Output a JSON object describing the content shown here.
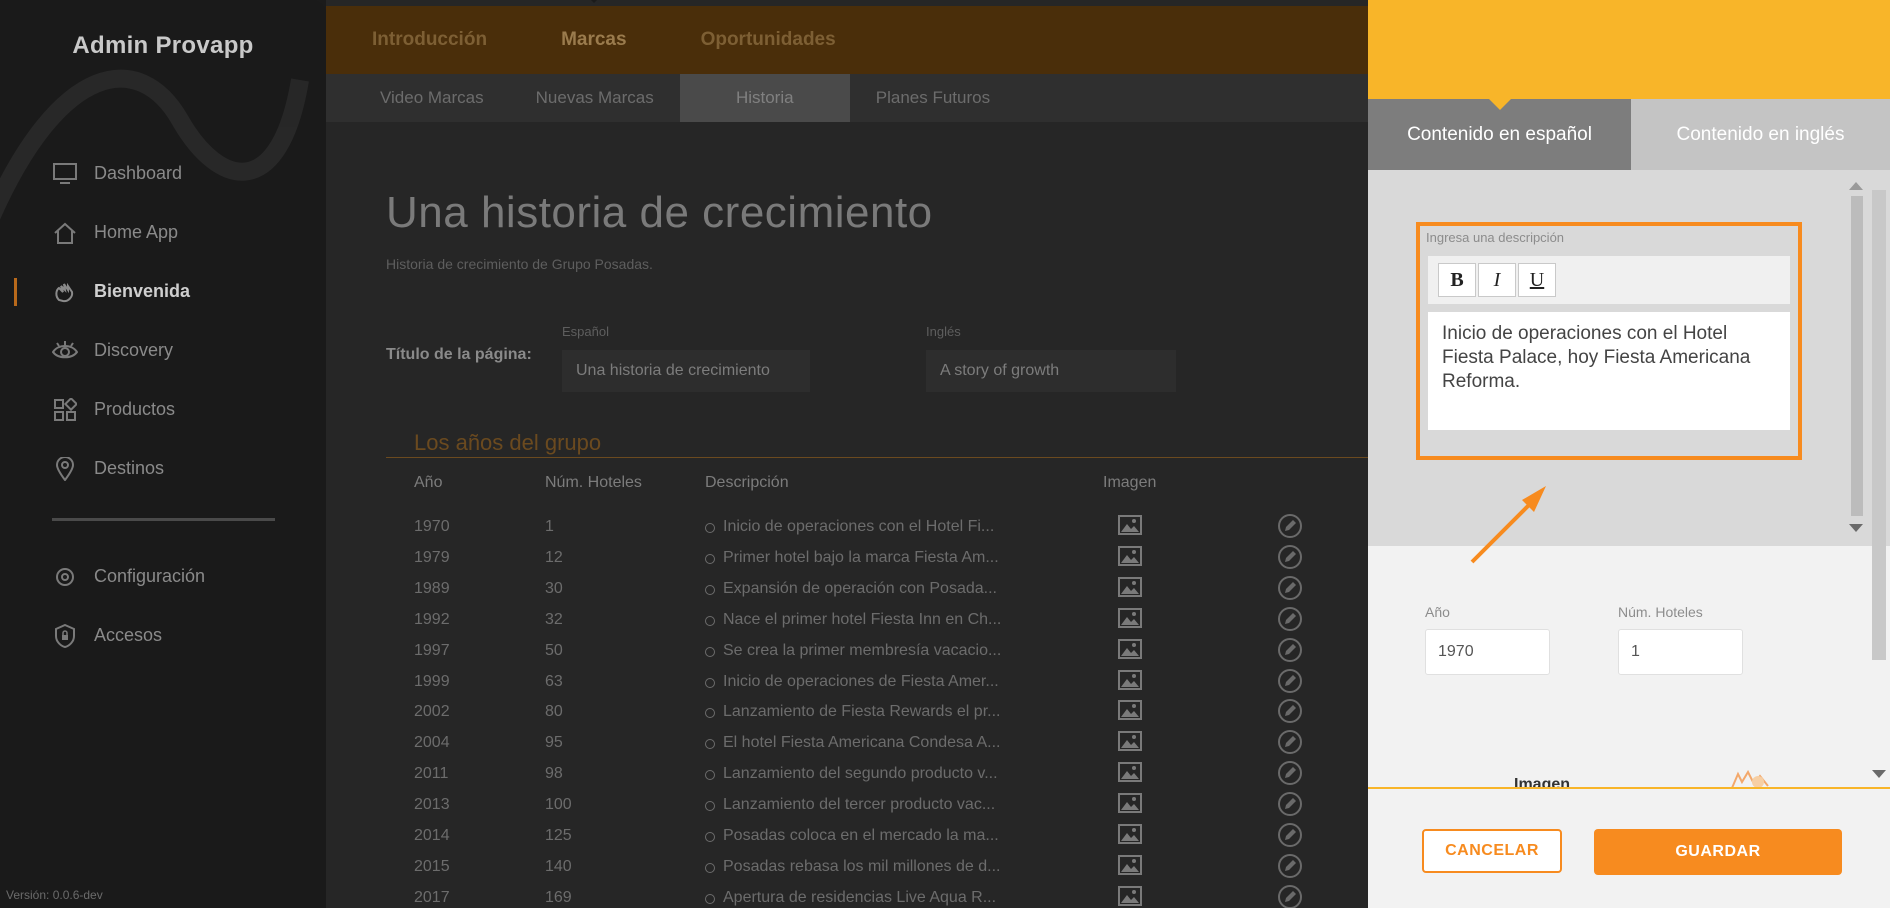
{
  "app": {
    "brand": "Admin Provapp",
    "version": "Versión: 0.0.6-dev"
  },
  "sidebar": {
    "items": [
      {
        "label": "Dashboard",
        "icon": "monitor-icon"
      },
      {
        "label": "Home App",
        "icon": "home-icon"
      },
      {
        "label": "Bienvenida",
        "icon": "wave-hand-icon",
        "active": true
      },
      {
        "label": "Discovery",
        "icon": "eye-icon"
      },
      {
        "label": "Productos",
        "icon": "grid-icon"
      },
      {
        "label": "Destinos",
        "icon": "location-pin-icon"
      }
    ],
    "bottom_items": [
      {
        "label": "Configuración",
        "icon": "gear-icon"
      },
      {
        "label": "Accesos",
        "icon": "shield-lock-icon"
      }
    ]
  },
  "topnav": {
    "items": [
      "Introducción",
      "Marcas",
      "Oportunidades"
    ],
    "active": "Marcas"
  },
  "subnav": {
    "items": [
      "Video Marcas",
      "Nuevas Marcas",
      "Historia",
      "Planes Futuros"
    ],
    "active": "Historia"
  },
  "page": {
    "title": "Una historia de crecimiento",
    "subtitle": "Historia de crecimiento de Grupo Posadas.",
    "title_field_label": "Título de la página:",
    "lang_es": "Español",
    "lang_en": "Inglés",
    "title_es": "Una historia de crecimiento",
    "title_en": "A story of growth",
    "section": "Los años del grupo"
  },
  "table": {
    "headers": {
      "year": "Año",
      "hotels": "Núm. Hoteles",
      "description": "Descripción",
      "image": "Imagen"
    },
    "rows": [
      {
        "year": "1970",
        "hotels": "1",
        "desc": "Inicio de operaciones con el Hotel Fi..."
      },
      {
        "year": "1979",
        "hotels": "12",
        "desc": "Primer hotel bajo la marca Fiesta Am..."
      },
      {
        "year": "1989",
        "hotels": "30",
        "desc": "Expansión de operación con Posada..."
      },
      {
        "year": "1992",
        "hotels": "32",
        "desc": "Nace el primer hotel Fiesta Inn en Ch..."
      },
      {
        "year": "1997",
        "hotels": "50",
        "desc": "Se crea la primer membresía vacacio..."
      },
      {
        "year": "1999",
        "hotels": "63",
        "desc": "Inicio de operaciones de Fiesta Amer..."
      },
      {
        "year": "2002",
        "hotels": "80",
        "desc": "Lanzamiento de Fiesta Rewards el pr..."
      },
      {
        "year": "2004",
        "hotels": "95",
        "desc": "El hotel Fiesta Americana Condesa A..."
      },
      {
        "year": "2011",
        "hotels": "98",
        "desc": "Lanzamiento del segundo producto v..."
      },
      {
        "year": "2013",
        "hotels": "100",
        "desc": "Lanzamiento del tercer producto vac..."
      },
      {
        "year": "2014",
        "hotels": "125",
        "desc": "Posadas coloca en el mercado la ma..."
      },
      {
        "year": "2015",
        "hotels": "140",
        "desc": "Posadas rebasa los mil millones de d..."
      },
      {
        "year": "2017",
        "hotels": "169",
        "desc": "Apertura de residencias Live Aqua R..."
      }
    ]
  },
  "panel": {
    "tabs": {
      "es": "Contenido en español",
      "en": "Contenido en inglés"
    },
    "editor": {
      "label": "Ingresa una descripción",
      "bold": "B",
      "italic": "I",
      "underline": "U",
      "text": "Inicio de operaciones con el Hotel Fiesta Palace, hoy Fiesta Americana Reforma."
    },
    "year_label": "Año",
    "year_value": "1970",
    "hotels_label": "Núm. Hoteles",
    "hotels_value": "1",
    "image_label": "Imagen",
    "cancel": "CANCELAR",
    "save": "GUARDAR"
  },
  "colors": {
    "accent": "#f78b1f",
    "header": "#f8b529",
    "sidebar": "#1a1a1a"
  }
}
